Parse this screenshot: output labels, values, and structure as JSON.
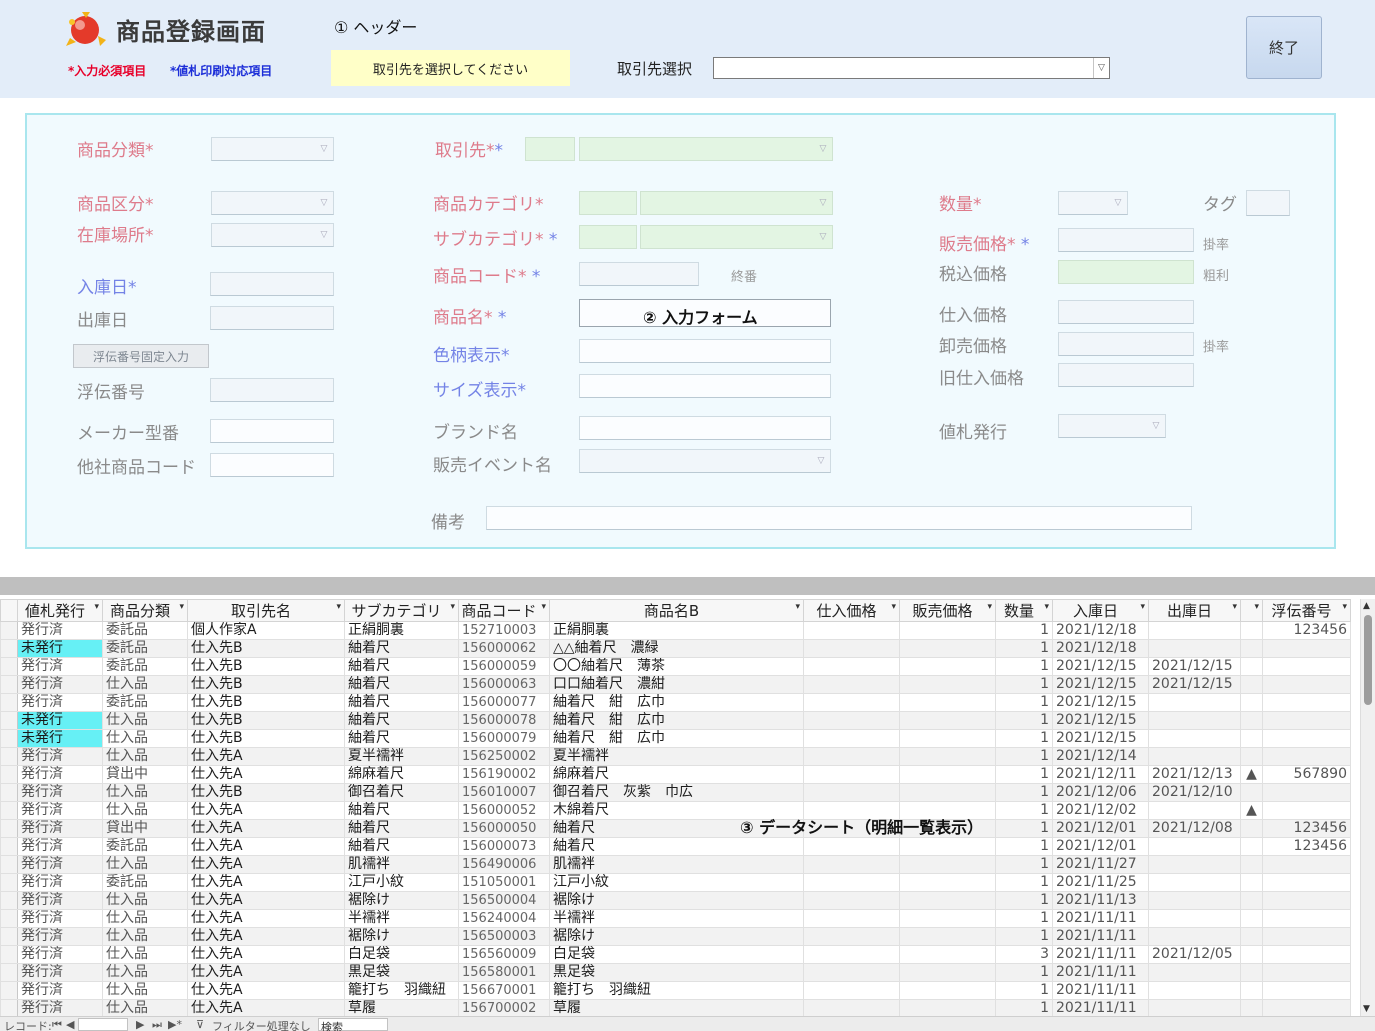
{
  "header": {
    "title": "商品登録画面",
    "legend_required": "*入力必須項目",
    "legend_price_tag": "*値札印刷対応項目",
    "section_annotation": "① ヘッダー",
    "prompt": "取引先を選択してください",
    "supplier_select_label": "取引先選択",
    "supplier_select_value": "",
    "exit_label": "終了"
  },
  "form": {
    "annotation": "② 入力フォーム",
    "labels": {
      "category": "商品分類",
      "type": "商品区分",
      "location": "在庫場所",
      "arrival": "入庫日",
      "shipping": "出庫日",
      "fix_button": "浮伝番号固定入力",
      "slip_no": "浮伝番号",
      "maker_no": "メーカー型番",
      "other_code": "他社商品コード",
      "supplier": "取引先",
      "item_category": "商品カテゴリ",
      "sub_category": "サブカテゴリ",
      "item_code": "商品コード",
      "end_no": "終番",
      "item_name": "商品名",
      "color": "色柄表示",
      "size": "サイズ表示",
      "brand": "ブランド名",
      "event": "販売イベント名",
      "note": "備考",
      "quantity": "数量",
      "tag": "タグ",
      "sale_price": "販売価格",
      "rate1": "掛率",
      "tax_price": "税込価格",
      "gross": "粗利",
      "purchase": "仕入価格",
      "wholesale": "卸売価格",
      "rate2": "掛率",
      "old_purchase": "旧仕入価格",
      "tag_issue": "値札発行"
    }
  },
  "sheet": {
    "annotation": "③ データシート（明細一覧表示）",
    "columns": [
      "値札発行",
      "商品分類",
      "取引先名",
      "サブカテゴリ",
      "商品コード",
      "商品名B",
      "仕入価格",
      "販売価格",
      "数量",
      "入庫日",
      "出庫日",
      "",
      "浮伝番号"
    ],
    "rows": [
      [
        "発行済",
        "委託品",
        "個人作家A",
        "正絹胴裏",
        "152710003",
        "正絹胴裏",
        "",
        "",
        "1",
        "2021/12/18",
        "",
        "",
        "123456"
      ],
      [
        "未発行",
        "委託品",
        "仕入先B",
        "紬着尺",
        "156000062",
        "△△紬着尺　濃緑",
        "",
        "",
        "1",
        "2021/12/18",
        "",
        "",
        ""
      ],
      [
        "発行済",
        "委託品",
        "仕入先B",
        "紬着尺",
        "156000059",
        "〇〇紬着尺　薄茶",
        "",
        "",
        "1",
        "2021/12/15",
        "2021/12/15",
        "",
        ""
      ],
      [
        "発行済",
        "仕入品",
        "仕入先B",
        "紬着尺",
        "156000063",
        "口口紬着尺　濃紺",
        "",
        "",
        "1",
        "2021/12/15",
        "2021/12/15",
        "",
        ""
      ],
      [
        "発行済",
        "委託品",
        "仕入先B",
        "紬着尺",
        "156000077",
        "紬着尺　紺　広巾",
        "",
        "",
        "1",
        "2021/12/15",
        "",
        "",
        ""
      ],
      [
        "未発行",
        "仕入品",
        "仕入先B",
        "紬着尺",
        "156000078",
        "紬着尺　紺　広巾",
        "",
        "",
        "1",
        "2021/12/15",
        "",
        "",
        ""
      ],
      [
        "未発行",
        "仕入品",
        "仕入先B",
        "紬着尺",
        "156000079",
        "紬着尺　紺　広巾",
        "",
        "",
        "1",
        "2021/12/15",
        "",
        "",
        ""
      ],
      [
        "発行済",
        "仕入品",
        "仕入先A",
        "夏半襦袢",
        "156250002",
        "夏半襦袢",
        "",
        "",
        "1",
        "2021/12/14",
        "",
        "",
        ""
      ],
      [
        "発行済",
        "貸出中",
        "仕入先A",
        "綿麻着尺",
        "156190002",
        "綿麻着尺",
        "",
        "",
        "1",
        "2021/12/11",
        "2021/12/13",
        "▲",
        "567890"
      ],
      [
        "発行済",
        "仕入品",
        "仕入先B",
        "御召着尺",
        "156010007",
        "御召着尺　灰紫　巾広",
        "",
        "",
        "1",
        "2021/12/06",
        "2021/12/10",
        "",
        ""
      ],
      [
        "発行済",
        "仕入品",
        "仕入先A",
        "紬着尺",
        "156000052",
        "木綿着尺",
        "",
        "",
        "1",
        "2021/12/02",
        "",
        "▲",
        ""
      ],
      [
        "発行済",
        "貸出中",
        "仕入先A",
        "紬着尺",
        "156000050",
        "紬着尺",
        "",
        "",
        "1",
        "2021/12/01",
        "2021/12/08",
        "",
        "123456"
      ],
      [
        "発行済",
        "委託品",
        "仕入先A",
        "紬着尺",
        "156000073",
        "紬着尺",
        "",
        "",
        "1",
        "2021/12/01",
        "",
        "",
        "123456"
      ],
      [
        "発行済",
        "仕入品",
        "仕入先A",
        "肌襦袢",
        "156490006",
        "肌襦袢",
        "",
        "",
        "1",
        "2021/11/27",
        "",
        "",
        ""
      ],
      [
        "発行済",
        "委託品",
        "仕入先A",
        "江戸小紋",
        "151050001",
        "江戸小紋",
        "",
        "",
        "1",
        "2021/11/25",
        "",
        "",
        ""
      ],
      [
        "発行済",
        "仕入品",
        "仕入先A",
        "裾除け",
        "156500004",
        "裾除け",
        "",
        "",
        "1",
        "2021/11/13",
        "",
        "",
        ""
      ],
      [
        "発行済",
        "仕入品",
        "仕入先A",
        "半襦袢",
        "156240004",
        "半襦袢",
        "",
        "",
        "1",
        "2021/11/11",
        "",
        "",
        ""
      ],
      [
        "発行済",
        "仕入品",
        "仕入先A",
        "裾除け",
        "156500003",
        "裾除け",
        "",
        "",
        "1",
        "2021/11/11",
        "",
        "",
        ""
      ],
      [
        "発行済",
        "仕入品",
        "仕入先A",
        "白足袋",
        "156560009",
        "白足袋",
        "",
        "",
        "3",
        "2021/11/11",
        "2021/12/05",
        "",
        ""
      ],
      [
        "発行済",
        "仕入品",
        "仕入先A",
        "黒足袋",
        "156580001",
        "黒足袋",
        "",
        "",
        "1",
        "2021/11/11",
        "",
        "",
        ""
      ],
      [
        "発行済",
        "仕入品",
        "仕入先A",
        "籠打ち　羽織紐",
        "156670001",
        "籠打ち　羽織紐",
        "",
        "",
        "1",
        "2021/11/11",
        "",
        "",
        ""
      ],
      [
        "発行済",
        "仕入品",
        "仕入先A",
        "草履",
        "156700002",
        "草履",
        "",
        "",
        "1",
        "2021/11/11",
        "",
        "",
        ""
      ]
    ]
  },
  "navbar": {
    "record_label": "レコード:",
    "filter_label": "フィルター処理なし",
    "search_label": "検索"
  },
  "colors": {
    "header_bg": "#e3edf9",
    "form_bg": "#f1fafe",
    "required_red": "#e8002a",
    "price_blue": "#1c2ed8",
    "unissued_highlight": "#66f0f5"
  }
}
